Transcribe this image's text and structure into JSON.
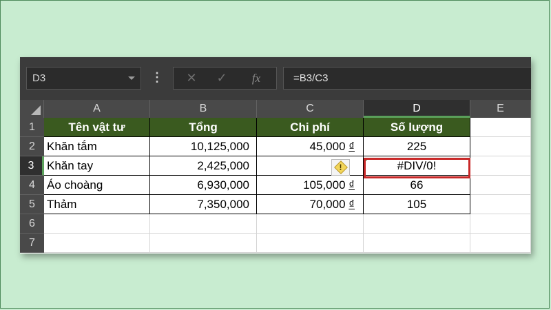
{
  "name_box": "D3",
  "formula_bar": {
    "more_icon": "⋮",
    "cancel_icon": "✕",
    "enter_icon": "✓",
    "function_icon": "fx",
    "formula": "=B3/C3"
  },
  "columns": [
    "A",
    "B",
    "C",
    "D",
    "E"
  ],
  "rows": [
    "1",
    "2",
    "3",
    "4",
    "5",
    "6",
    "7"
  ],
  "header_row": [
    "Tên vật tư",
    "Tổng",
    "Chi phí",
    "Số lượng"
  ],
  "data_rows": [
    {
      "name": "Khăn tắm",
      "total": "10,125,000",
      "cost": "45,000",
      "currency": "₫",
      "qty": "225"
    },
    {
      "name": "Khăn tay",
      "total": "2,425,000",
      "cost": "",
      "currency": "",
      "qty": "#DIV/0!"
    },
    {
      "name": "Áo choàng",
      "total": "6,930,000",
      "cost": "105,000",
      "currency": "₫",
      "qty": "66"
    },
    {
      "name": "Thảm",
      "total": "7,350,000",
      "cost": "70,000",
      "currency": "₫",
      "qty": "105"
    }
  ],
  "selected_cell": "D3",
  "colors": {
    "header_fill": "#3a5a1f",
    "highlight": "#c82828",
    "background": "#c8ecd0"
  },
  "icons": {
    "error_warning": "warning-diamond-icon"
  }
}
